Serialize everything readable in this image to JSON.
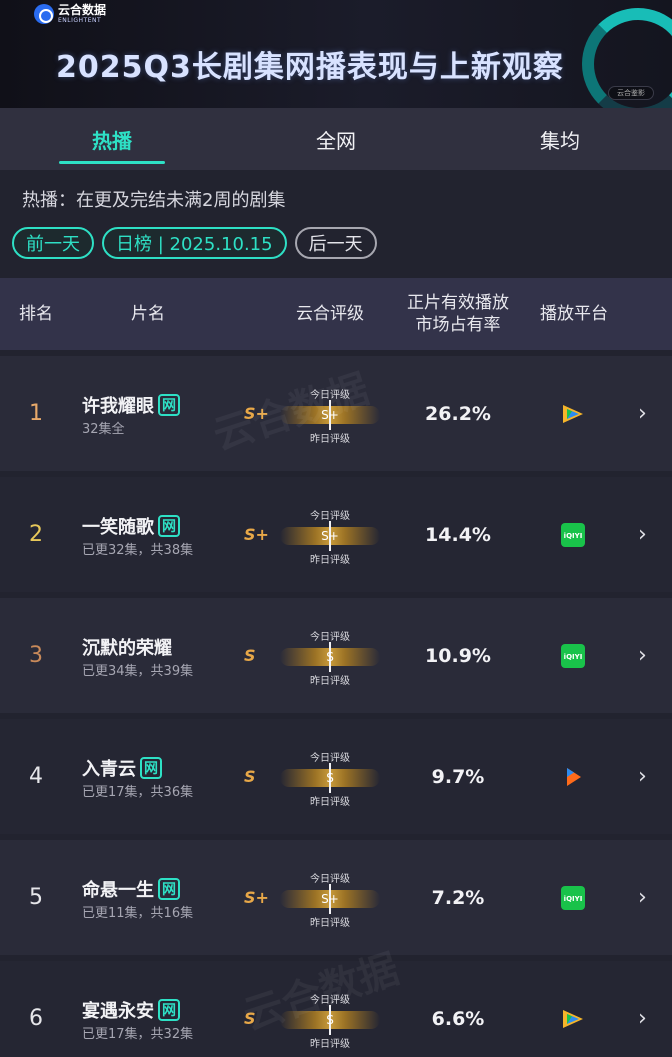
{
  "banner": {
    "logo_cn": "云合数据",
    "logo_en": "ENLIGHTENT",
    "title": "2025Q3长剧集网播表现与上新观察",
    "badge": "云合鉴影"
  },
  "tabs": [
    {
      "label": "热播",
      "active": true
    },
    {
      "label": "全网",
      "active": false
    },
    {
      "label": "集均",
      "active": false
    }
  ],
  "description": "热播：在更及完结未满2周的剧集",
  "date_controls": {
    "prev": "前一天",
    "current": "日榜 | 2025.10.15",
    "next": "后一天"
  },
  "table": {
    "headers": {
      "rank": "排名",
      "title": "片名",
      "grade": "云合评级",
      "share_line1": "正片有效播放",
      "share_line2": "市场占有率",
      "platform": "播放平台"
    },
    "gauge_labels": {
      "today": "今日评级",
      "yesterday": "昨日评级"
    },
    "rows": [
      {
        "rank": "1",
        "title": "许我耀眼",
        "net": "网",
        "sub": "32集全",
        "grade": "S+",
        "share": "26.2%",
        "platform": "tencent-video-icon"
      },
      {
        "rank": "2",
        "title": "一笑随歌",
        "net": "网",
        "sub": "已更32集，共38集",
        "grade": "S+",
        "share": "14.4%",
        "platform": "iqiyi-icon"
      },
      {
        "rank": "3",
        "title": "沉默的荣耀",
        "net": "",
        "sub": "已更34集，共39集",
        "grade": "S",
        "share": "10.9%",
        "platform": "iqiyi-icon"
      },
      {
        "rank": "4",
        "title": "入青云",
        "net": "网",
        "sub": "已更17集，共36集",
        "grade": "S",
        "share": "9.7%",
        "platform": "youku-icon"
      },
      {
        "rank": "5",
        "title": "命悬一生",
        "net": "网",
        "sub": "已更11集，共16集",
        "grade": "S+",
        "share": "7.2%",
        "platform": "iqiyi-icon"
      },
      {
        "rank": "6",
        "title": "宴遇永安",
        "net": "网",
        "sub": "已更17集，共32集",
        "grade": "S",
        "share": "6.6%",
        "platform": "tencent-video-icon"
      }
    ]
  },
  "colors": {
    "accent": "#2ee0c5",
    "grade": "#e8a848",
    "iqiyi": "#19c24a",
    "tencent": "#2d8cf0",
    "youku": "#ff6b1a"
  }
}
